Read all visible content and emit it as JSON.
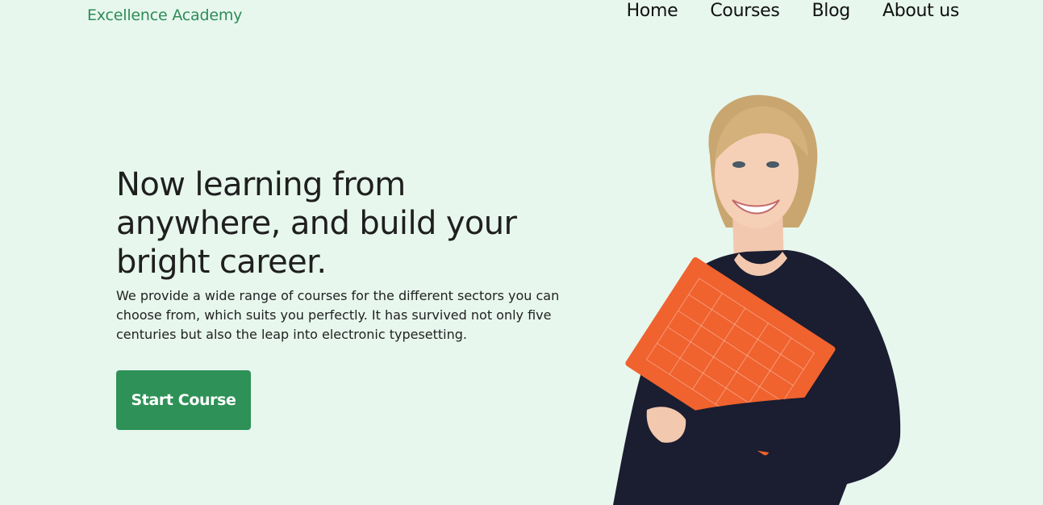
{
  "brand": {
    "name": "Excellence Academy",
    "color": "#2e8b57"
  },
  "nav": {
    "items": [
      {
        "label": "Home"
      },
      {
        "label": "Courses"
      },
      {
        "label": "Blog"
      },
      {
        "label": "About us"
      }
    ]
  },
  "hero": {
    "title": "Now learning from anywhere, and build your bright career.",
    "description": "We provide a wide range of courses for the different sectors you can choose from, which suits you perfectly. It has survived not only five centuries but also the leap into electronic typesetting.",
    "cta_label": "Start Course"
  },
  "colors": {
    "background": "#e7f7ee",
    "accent": "#2e9157",
    "folder": "#f0622e",
    "sweater": "#1b1d30"
  }
}
